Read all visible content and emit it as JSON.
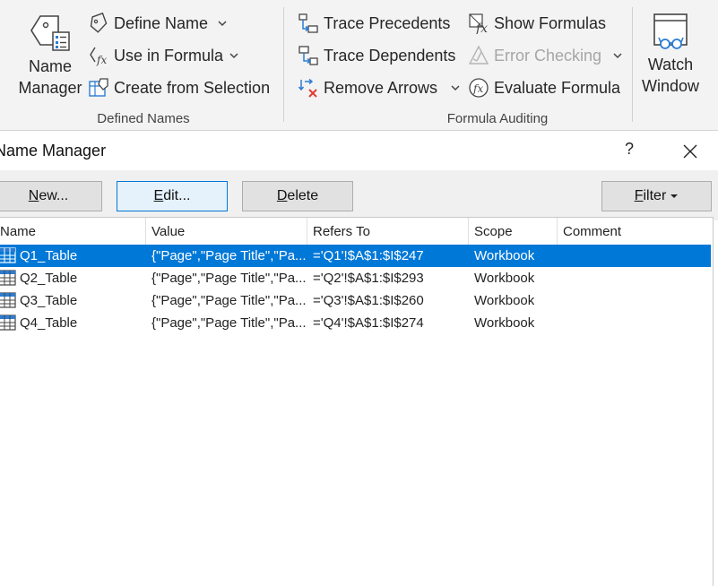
{
  "ribbon": {
    "defined_names": {
      "group_label": "Defined Names",
      "name_manager_line1": "Name",
      "name_manager_line2": "Manager",
      "define_name": "Define Name",
      "use_in_formula": "Use in Formula",
      "create_from_selection": "Create from Selection"
    },
    "formula_auditing": {
      "group_label": "Formula Auditing",
      "trace_precedents": "Trace Precedents",
      "trace_dependents": "Trace Dependents",
      "remove_arrows": "Remove Arrows",
      "show_formulas": "Show Formulas",
      "error_checking": "Error Checking",
      "evaluate_formula": "Evaluate Formula"
    },
    "watch_window_line1": "Watch",
    "watch_window_line2": "Window"
  },
  "dialog": {
    "title": "Name Manager",
    "help": "?",
    "buttons": {
      "new_u": "N",
      "new_rest": "ew...",
      "edit_u": "E",
      "edit_rest": "dit...",
      "delete_u": "D",
      "delete_rest": "elete",
      "filter_u": "F",
      "filter_rest": "ilter"
    },
    "columns": [
      "Name",
      "Value",
      "Refers To",
      "Scope",
      "Comment"
    ],
    "rows": [
      {
        "name": "Q1_Table",
        "value": "{\"Page\",\"Page Title\",\"Pa...",
        "refers_to": "='Q1'!$A$1:$I$247",
        "scope": "Workbook",
        "comment": ""
      },
      {
        "name": "Q2_Table",
        "value": "{\"Page\",\"Page Title\",\"Pa...",
        "refers_to": "='Q2'!$A$1:$I$293",
        "scope": "Workbook",
        "comment": ""
      },
      {
        "name": "Q3_Table",
        "value": "{\"Page\",\"Page Title\",\"Pa...",
        "refers_to": "='Q3'!$A$1:$I$260",
        "scope": "Workbook",
        "comment": ""
      },
      {
        "name": "Q4_Table",
        "value": "{\"Page\",\"Page Title\",\"Pa...",
        "refers_to": "='Q4'!$A$1:$I$274",
        "scope": "Workbook",
        "comment": ""
      }
    ],
    "selected_row": 0
  },
  "colors": {
    "accent": "#0078d7",
    "selection": "#0078d7",
    "disabled_text": "#a6a6a6"
  },
  "icons": [
    "name-manager-icon",
    "define-name-icon",
    "use-in-formula-icon",
    "create-from-selection-icon",
    "trace-precedents-icon",
    "trace-dependents-icon",
    "remove-arrows-icon",
    "show-formulas-icon",
    "error-checking-icon",
    "evaluate-formula-icon",
    "watch-window-icon",
    "table-icon",
    "close-icon"
  ]
}
